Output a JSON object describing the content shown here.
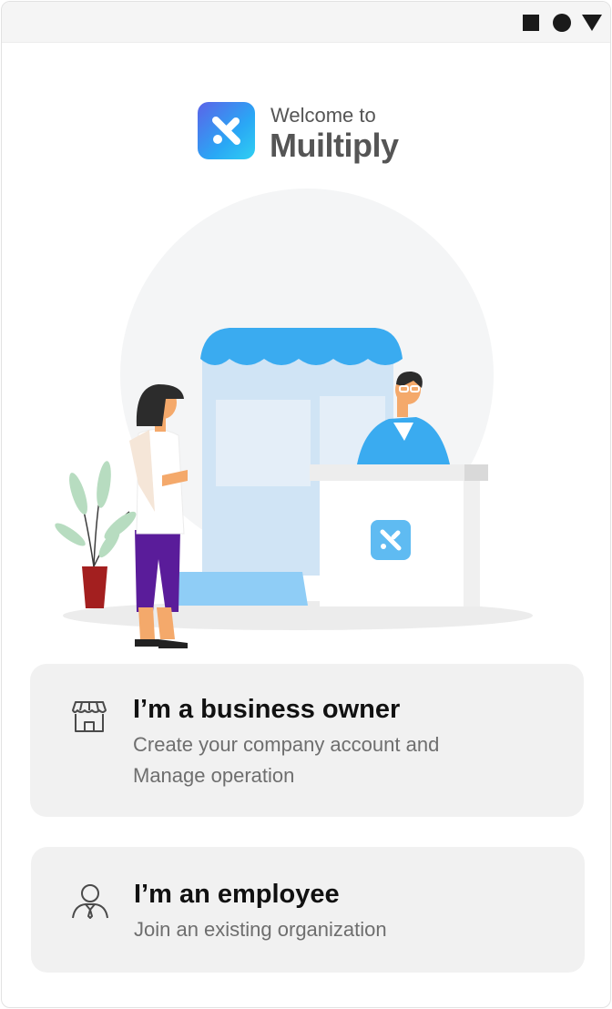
{
  "status_bar": {
    "icons": [
      "square-icon",
      "circle-icon",
      "triangle-icon"
    ]
  },
  "brand": {
    "welcome": "Welcome to",
    "app_name": "Muiltiply",
    "logo_colors": [
      "#5b63e8",
      "#2aa7f5",
      "#2fd0f2"
    ]
  },
  "options": {
    "owner": {
      "icon": "store-icon",
      "title": "I’m a business owner",
      "description": "Create your company account and Manage operation"
    },
    "employee": {
      "icon": "person-icon",
      "title": "I’m an employee",
      "description": "Join an existing organization"
    }
  },
  "colors": {
    "accent": "#3aabf0",
    "card_background": "#f1f1f1",
    "title_text": "#111111",
    "secondary_text": "#6e6e6e"
  }
}
